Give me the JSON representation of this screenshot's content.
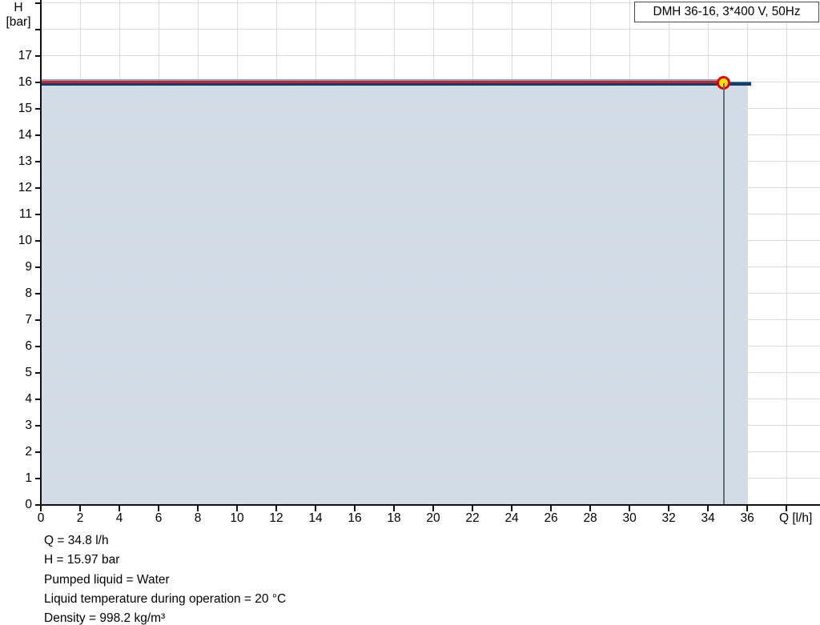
{
  "legend": {
    "label": "DMH 36-16, 3*400 V, 50Hz"
  },
  "axes": {
    "y_title_line1": "H",
    "y_title_line2": "[bar]",
    "x_title": "Q [l/h]"
  },
  "footer": {
    "lines": [
      "Q = 34.8 l/h",
      "H = 15.97 bar",
      "Pumped liquid = Water",
      "Liquid temperature during operation = 20 °C",
      "Density = 998.2 kg/m³"
    ]
  },
  "chart_data": {
    "type": "line",
    "title": "DMH 36-16, 3*400 V, 50Hz",
    "xlabel": "Q [l/h]",
    "ylabel": "H [bar]",
    "xlim": [
      0,
      39.71
    ],
    "ylim": [
      0,
      19.12
    ],
    "grid": true,
    "legend_position": "top-right",
    "x_tick_values": [
      0,
      2,
      4,
      6,
      8,
      10,
      12,
      14,
      16,
      18,
      20,
      22,
      24,
      26,
      28,
      30,
      32,
      34,
      36,
      38
    ],
    "x_tick_labels": [
      "0",
      "2",
      "4",
      "6",
      "8",
      "10",
      "12",
      "14",
      "16",
      "18",
      "20",
      "22",
      "24",
      "26",
      "28",
      "30",
      "32",
      "34",
      "36"
    ],
    "y_tick_values": [
      0,
      1,
      2,
      3,
      4,
      5,
      6,
      7,
      8,
      9,
      10,
      11,
      12,
      13,
      14,
      15,
      16,
      17,
      18,
      19
    ],
    "y_tick_labels": [
      "0",
      "1",
      "2",
      "3",
      "4",
      "5",
      "6",
      "7",
      "8",
      "9",
      "10",
      "11",
      "12",
      "13",
      "14",
      "15",
      "16",
      "17"
    ],
    "series": [
      {
        "name": "pump-curve",
        "label": "DMH 36-16, 3*400 V, 50Hz",
        "color": "#123f6d",
        "points": [
          [
            0,
            15.97
          ],
          [
            36.2,
            15.97
          ]
        ]
      },
      {
        "name": "selected-range-highlight",
        "color": "#ce2025",
        "points": [
          [
            0,
            15.97
          ],
          [
            34.8,
            15.97
          ]
        ]
      }
    ],
    "fill_under_curve": {
      "x_range": [
        0,
        36.05
      ],
      "top": 15.97,
      "color": "#d2dce6"
    },
    "operating_point": {
      "Q": 34.8,
      "H": 15.97,
      "marker_fill": "#ffe202",
      "marker_ring": "#e60000"
    },
    "colors": {
      "grid": "#d9dddd",
      "axis": "#111111",
      "drop_line": "#5d6d79",
      "curve_top_edge": "#7ba4ca",
      "curve_upper": "#5d87b0"
    }
  }
}
